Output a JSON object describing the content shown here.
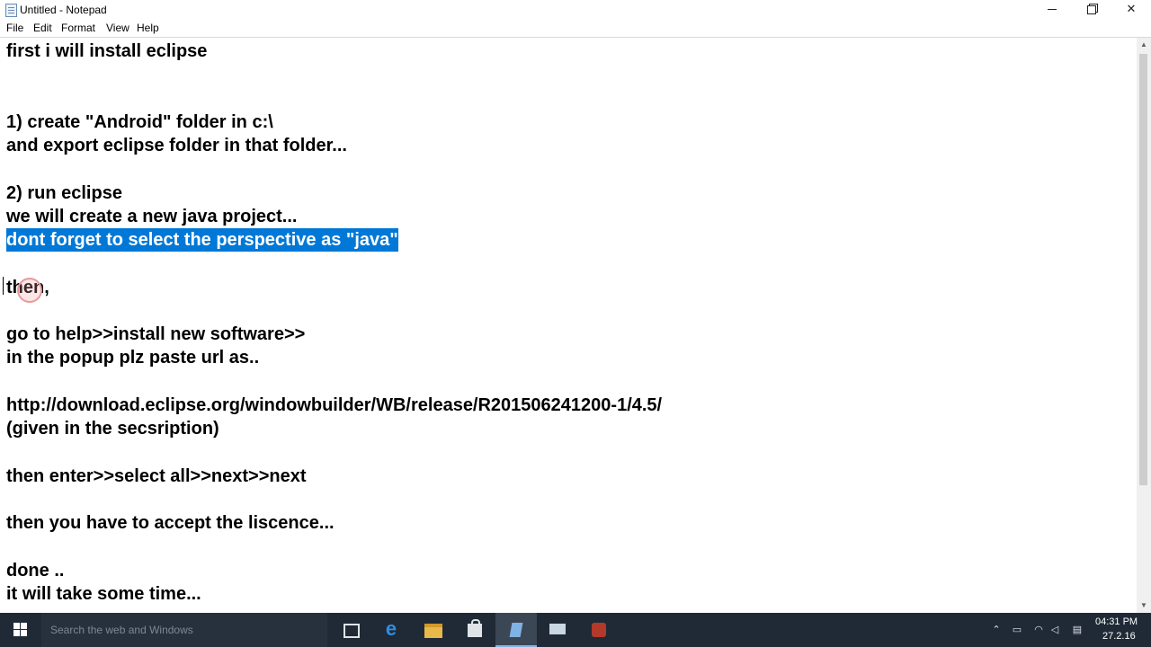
{
  "window": {
    "title": "Untitled - Notepad",
    "minimize_glyph": "",
    "close_glyph": "✕"
  },
  "menu": [
    "File",
    "Edit",
    "Format",
    "View",
    "Help"
  ],
  "editor": {
    "lines": [
      "first i will install eclipse",
      "",
      "",
      "1) create \"Android\" folder in c:\\",
      "and export eclipse folder in that folder...",
      "",
      "2) run eclipse",
      "we will create a new java project...",
      "dont forget to select the perspective as \"java\"",
      "",
      "then,",
      "",
      "go to help>>install new software>>",
      "in the popup plz paste url as..",
      "",
      "http://download.eclipse.org/windowbuilder/WB/release/R201506241200-1/4.5/",
      "(given in the secsription)",
      "",
      "then enter>>select all>>next>>next",
      "",
      "then you have to accept the liscence...",
      "",
      "done ..",
      "it will take some time..."
    ],
    "selected_line_index": 8
  },
  "taskbar": {
    "search_placeholder": "Search the web and Windows",
    "clock_time": "04:31 PM",
    "clock_date": "27.2.16",
    "colors": {
      "background": "#1f2a36",
      "selection": "#0078d7"
    }
  }
}
